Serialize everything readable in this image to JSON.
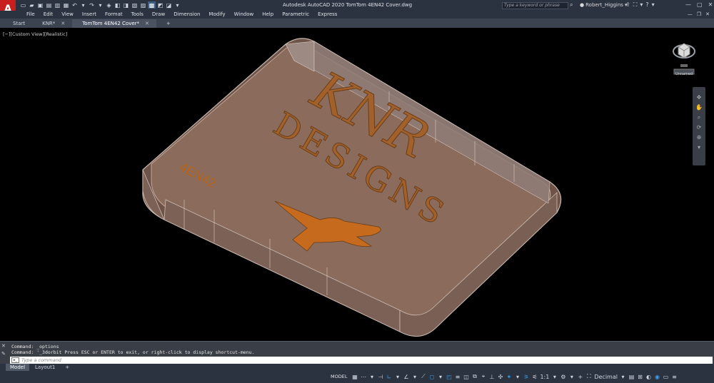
{
  "app": {
    "logo_letter": "A",
    "title": "Autodesk AutoCAD 2020    TomTom 4EN42 Cover.dwg",
    "search_placeholder": "Type a keyword or phrase",
    "user": "Robert_Higgins"
  },
  "quick_access": [
    "new-icon",
    "open-icon",
    "save-icon",
    "saveas-icon",
    "plot-icon",
    "plot-preview-icon",
    "undo-icon",
    "undo-dropdown-icon",
    "redo-icon",
    "redo-dropdown-icon",
    "match-props-icon",
    "layer-icon",
    "properties-icon",
    "print-icon",
    "layout-icon",
    "visual-style-icon",
    "share-icon",
    "workspace-icon",
    "more-icon"
  ],
  "menu": [
    "File",
    "Edit",
    "View",
    "Insert",
    "Format",
    "Tools",
    "Draw",
    "Dimension",
    "Modify",
    "Window",
    "Help",
    "Parametric",
    "Express"
  ],
  "tabs": [
    {
      "label": "Start",
      "closable": false,
      "active": false
    },
    {
      "label": "KNR*",
      "closable": true,
      "active": false
    },
    {
      "label": "TomTom 4EN42 Cover*",
      "closable": true,
      "active": true
    }
  ],
  "viewport": {
    "label": "[−][Custom View][Realistic]",
    "viewcube_label": "Unnamed",
    "model_text_large": "KNR",
    "model_text_designs": "DESIGNS",
    "model_text_part": "4EN42"
  },
  "command": {
    "history": [
      "Command: _options",
      "Command: '_3dorbit Press ESC or ENTER to exit, or right-click to display shortcut-menu."
    ],
    "placeholder": "Type a command"
  },
  "layouts": [
    "Model",
    "Layout1"
  ],
  "status": {
    "model": "MODEL",
    "scale": "1:1",
    "units": "Decimal"
  },
  "colors": {
    "chrome": "#2b3340",
    "model_face": "#8a6b5c",
    "model_letters": "#b5651d",
    "accent": "#3a9ee8"
  }
}
